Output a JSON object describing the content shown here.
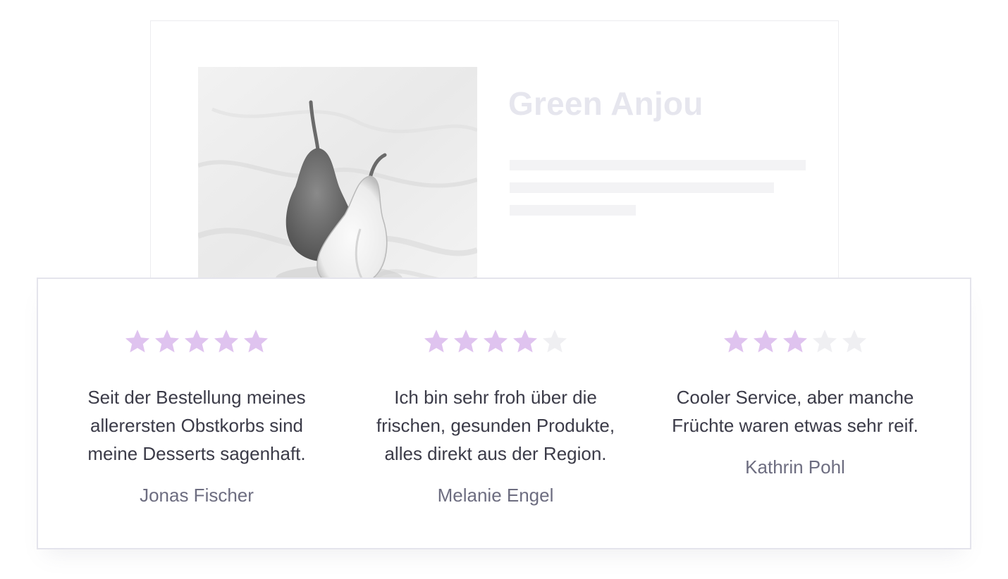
{
  "product": {
    "title": "Green Anjou",
    "image_icon": "pear-photo"
  },
  "colors": {
    "star_filled": "#dfc3ef",
    "star_empty": "#efeff2",
    "title_faded": "#e6e6ee",
    "review_text": "#3b3b48",
    "author_text": "#6d6d80"
  },
  "reviews": [
    {
      "rating": 5,
      "max_rating": 5,
      "text": "Seit der Bestellung meines allerersten Obstkorbs sind meine Desserts sagenhaft.",
      "author": "Jonas Fischer"
    },
    {
      "rating": 4,
      "max_rating": 5,
      "text": "Ich bin sehr froh über die frischen, gesunden Produkte, alles direkt aus der Region.",
      "author": "Melanie Engel"
    },
    {
      "rating": 3,
      "max_rating": 5,
      "text": "Cooler Service, aber manche Früchte waren etwas sehr reif.",
      "author": "Kathrin Pohl"
    }
  ]
}
